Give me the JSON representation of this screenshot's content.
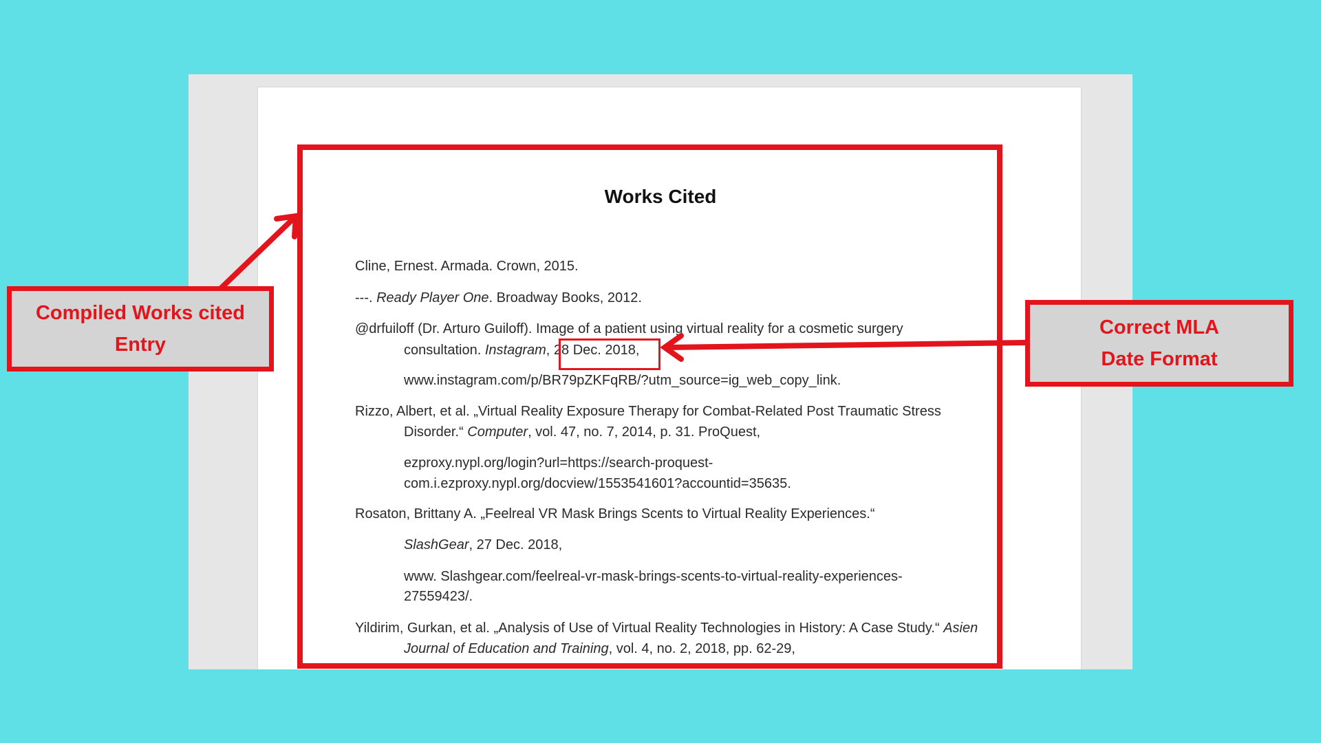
{
  "document": {
    "title": "Works Cited",
    "entries": [
      {
        "lines": [
          {
            "parts": [
              {
                "text": "Cline, Ernest. Armada. Crown, 2015."
              }
            ]
          }
        ]
      },
      {
        "lines": [
          {
            "parts": [
              {
                "text": "---. "
              },
              {
                "text": "Ready Player One",
                "italic": true
              },
              {
                "text": ". Broadway Books, 2012."
              }
            ]
          }
        ]
      },
      {
        "lines": [
          {
            "parts": [
              {
                "text": "@drfuiloff (Dr. Arturo Guiloff). Image of a patient using virtual reality for a cosmetic surgery"
              }
            ]
          },
          {
            "parts": [
              {
                "text": "consultation. "
              },
              {
                "text": "Instagram",
                "italic": true
              },
              {
                "text": ", 28 Dec. 2018,"
              }
            ]
          },
          {
            "parts": [
              {
                "text": "www.instagram.com/p/BR79pZKFqRB/?utm_source=ig_web_copy_link."
              }
            ]
          }
        ]
      },
      {
        "lines": [
          {
            "parts": [
              {
                "text": "Rizzo, Albert, et al. „Virtual Reality Exposure Therapy for Combat-Related Post Traumatic Stress"
              }
            ]
          },
          {
            "parts": [
              {
                "text": "Disorder.“ "
              },
              {
                "text": "Computer",
                "italic": true
              },
              {
                "text": ", vol. 47, no. 7, 2014, p. 31. ProQuest,"
              }
            ]
          },
          {
            "parts": [
              {
                "text": "ezproxy.nypl.org/login?url=https://search-proquest-"
              }
            ]
          },
          {
            "parts": [
              {
                "text": "com.i.ezproxy.nypl.org/docview/1553541601?accountid=35635."
              }
            ]
          }
        ]
      },
      {
        "lines": [
          {
            "parts": [
              {
                "text": "Rosaton, Brittany A. „Feelreal VR Mask Brings Scents to Virtual Reality Experiences.“"
              }
            ]
          },
          {
            "parts": [
              {
                "text": "SlashGear",
                "italic": true
              },
              {
                "text": ", 27 Dec. 2018,"
              }
            ]
          },
          {
            "parts": [
              {
                "text": "www. Slashgear.com/feelreal-vr-mask-brings-scents-to-virtual-reality-experiences-"
              }
            ]
          },
          {
            "parts": [
              {
                "text": "27559423/."
              }
            ]
          }
        ]
      },
      {
        "lines": [
          {
            "parts": [
              {
                "text": "Yildirim, Gurkan, et al. „Analysis of Use of Virtual Reality Technologies in History: A Case Study.“ "
              },
              {
                "text": "Asien",
                "italic": true
              }
            ]
          },
          {
            "parts": [
              {
                "text": "Journal of Education and Training",
                "italic": true
              },
              {
                "text": ", vol. 4, no. 2, 2018, pp. 62-29,"
              }
            ]
          }
        ]
      }
    ]
  },
  "callouts": {
    "left": {
      "line1": "Compiled Works cited",
      "line2": "Entry"
    },
    "right": {
      "line1": "Correct MLA",
      "line2": "Date Format"
    }
  },
  "colors": {
    "background": "#5ee0e6",
    "accent_red": "#e3141c",
    "callout_fill": "#d4d4d4"
  }
}
